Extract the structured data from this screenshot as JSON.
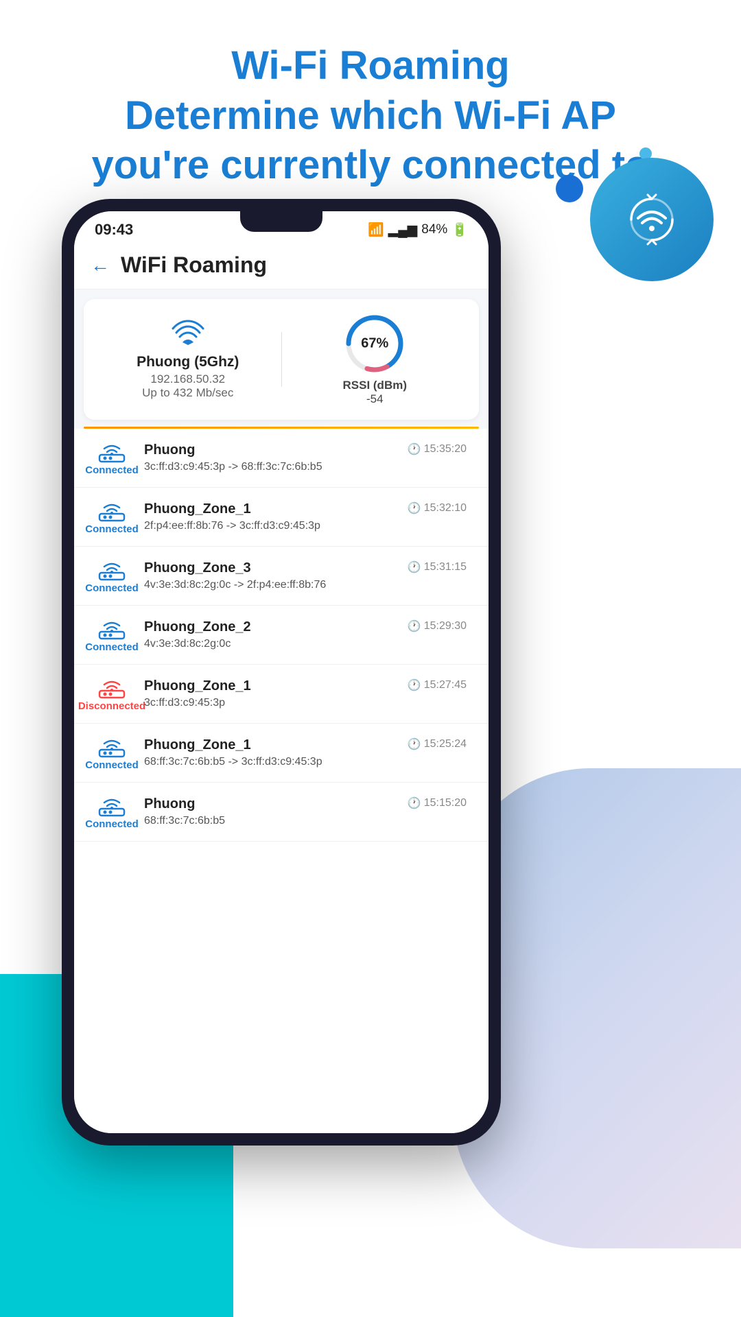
{
  "header": {
    "line1": "Wi-Fi Roaming",
    "line2": "Determine which Wi-Fi AP",
    "line3": "you're currently connected to"
  },
  "statusBar": {
    "time": "09:43",
    "battery": "84%",
    "signal": "▂▄▆",
    "wifi": "WiFi"
  },
  "appTitle": "WiFi Roaming",
  "backLabel": "←",
  "summary": {
    "ssid": "Phuong (5Ghz)",
    "ip": "192.168.50.32",
    "speed": "Up to 432 Mb/sec",
    "rssiPercent": "67%",
    "rssiLabel": "RSSI (dBm)",
    "rssiValue": "-54",
    "circleBlue": 240,
    "circlePink": 40,
    "circleTotal": 360
  },
  "connections": [
    {
      "status": "Connected",
      "name": "Phuong",
      "time": "15:35:20",
      "mac": "3c:ff:d3:c9:45:3p -> 68:ff:3c:7c:6b:b5",
      "isConnected": true
    },
    {
      "status": "Connected",
      "name": "Phuong_Zone_1",
      "time": "15:32:10",
      "mac": "2f:p4:ee:ff:8b:76 -> 3c:ff:d3:c9:45:3p",
      "isConnected": true
    },
    {
      "status": "Connected",
      "name": "Phuong_Zone_3",
      "time": "15:31:15",
      "mac": "4v:3e:3d:8c:2g:0c -> 2f:p4:ee:ff:8b:76",
      "isConnected": true
    },
    {
      "status": "Connected",
      "name": "Phuong_Zone_2",
      "time": "15:29:30",
      "mac": "4v:3e:3d:8c:2g:0c",
      "isConnected": true
    },
    {
      "status": "Disconnected",
      "name": "Phuong_Zone_1",
      "time": "15:27:45",
      "mac": "3c:ff:d3:c9:45:3p",
      "isConnected": false
    },
    {
      "status": "Connected",
      "name": "Phuong_Zone_1",
      "time": "15:25:24",
      "mac": "68:ff:3c:7c:6b:b5 -> 3c:ff:d3:c9:45:3p",
      "isConnected": true
    },
    {
      "status": "Connected",
      "name": "Phuong",
      "time": "15:15:20",
      "mac": "68:ff:3c:7c:6b:b5",
      "isConnected": true
    }
  ]
}
